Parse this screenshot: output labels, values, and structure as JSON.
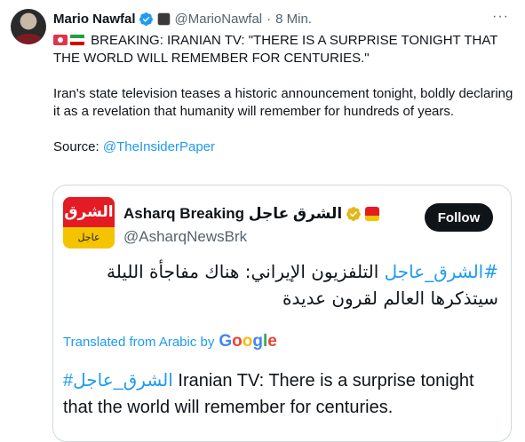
{
  "tweet": {
    "author_name": "Mario Nawfal",
    "handle": "@MarioNawfal",
    "separator": "·",
    "time": "8 Min.",
    "more_icon": "ellipsis-icon",
    "headline": "BREAKING: IRANIAN TV: \"THERE IS A SURPRISE TONIGHT THAT THE WORLD WILL REMEMBER FOR CENTURIES.\"",
    "body": "Iran's state television teases a historic announcement tonight, boldly declaring it as a revelation that humanity will remember for hundreds of years.",
    "source_label": "Source:",
    "source_link": "@TheInsiderPaper"
  },
  "quote": {
    "avatar_text_top": "الشرق",
    "avatar_text_bottom": "عاجل",
    "name": "Asharq Breaking الشرق عاجل",
    "handle": "@AsharqNewsBrk",
    "follow_label": "Follow",
    "arabic_hashtag": "#الشرق_عاجل",
    "arabic_text": " التلفزيون الإيراني: هناك مفاجأة الليلة سيتذكرها العالم لقرون عديدة",
    "translated_label": "Translated from Arabic by",
    "google_letters": [
      "G",
      "o",
      "o",
      "g",
      "l",
      "e"
    ],
    "translation_hashtag": "#الشرق_عاجل",
    "translation_text": " Iranian TV: There is a surprise tonight that the world will remember for centuries."
  },
  "colors": {
    "accent": "#1d9bf0",
    "text": "#0f1419",
    "muted": "#536471",
    "border": "#cfd9de",
    "asharq_red": "#e31b23",
    "asharq_yellow": "#f5c400"
  }
}
